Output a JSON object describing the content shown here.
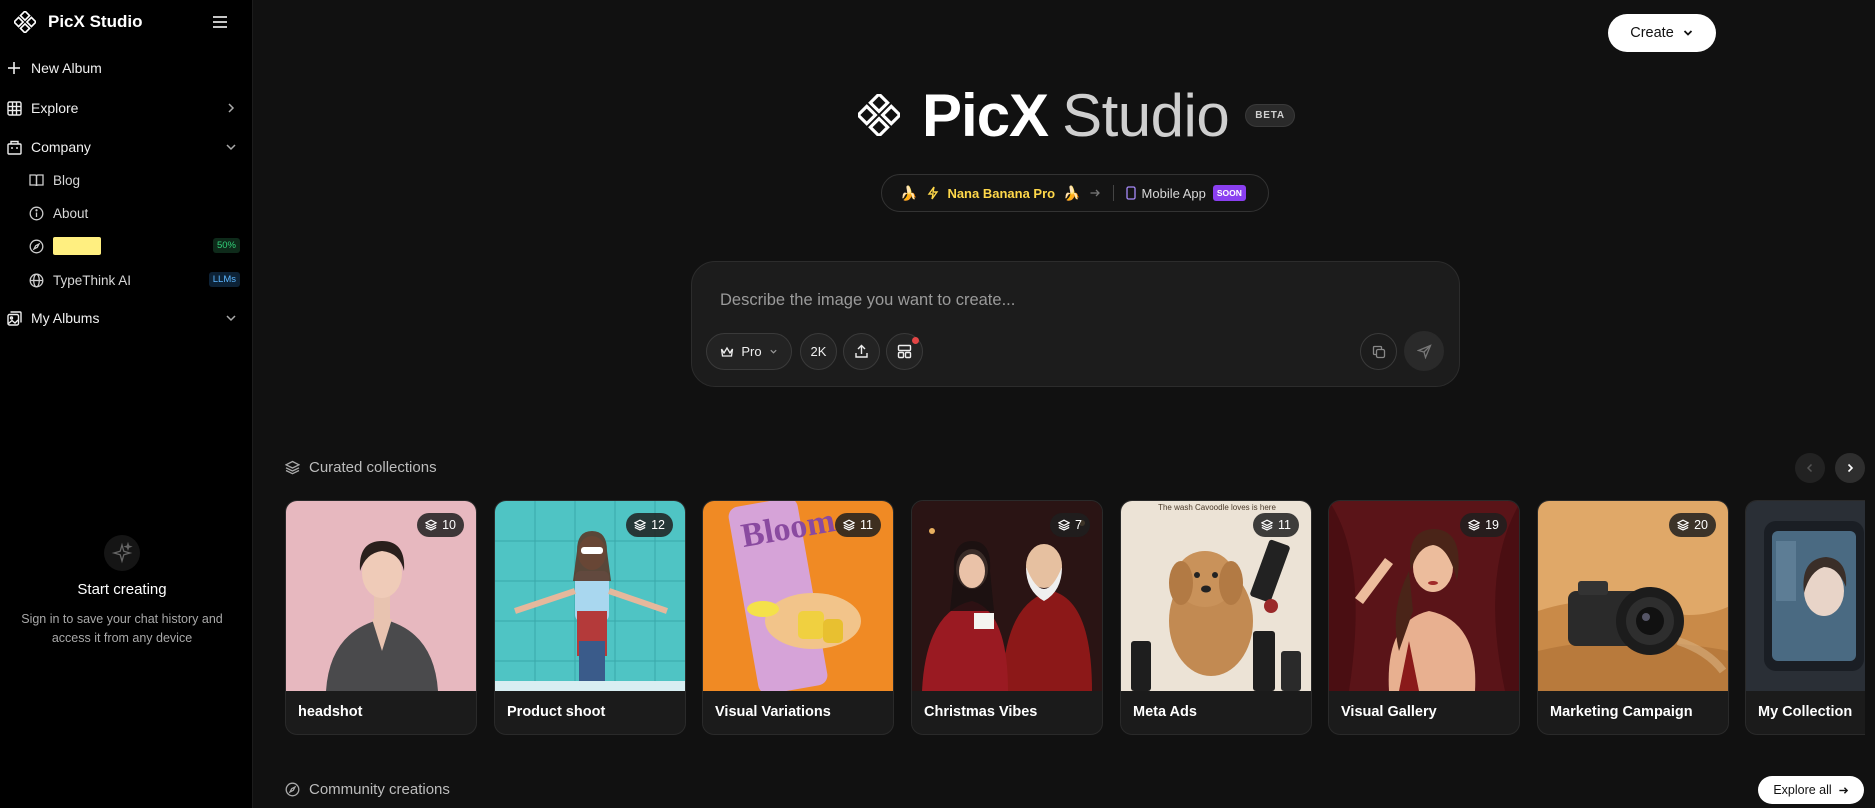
{
  "sidebar": {
    "brand": "PicX Studio",
    "new_album": "New Album",
    "explore": "Explore",
    "company": "Company",
    "company_items": [
      {
        "label": "Blog",
        "icon": "book-icon"
      },
      {
        "label": "About",
        "icon": "info-icon"
      },
      {
        "label": "",
        "icon": "compass-icon",
        "badge": "50%"
      },
      {
        "label": "TypeThink AI",
        "icon": "globe-icon",
        "badge": "LLMs"
      }
    ],
    "my_albums": "My Albums",
    "start": {
      "title": "Start creating",
      "desc_line1": "Sign in to save your chat history and",
      "desc_line2": "access it from any device"
    }
  },
  "header": {
    "create_label": "Create"
  },
  "hero": {
    "title_bold": "PicX",
    "title_light": "Studio",
    "beta": "BETA",
    "promo": "Nana Banana Pro",
    "mobile": "Mobile App",
    "soon": "SOON"
  },
  "composer": {
    "placeholder": "Describe the image you want to create...",
    "model": "Pro",
    "resolution": "2K"
  },
  "collections": {
    "title": "Curated collections",
    "items": [
      {
        "label": "headshot",
        "count": "10"
      },
      {
        "label": "Product shoot",
        "count": "12"
      },
      {
        "label": "Visual Variations",
        "count": "11"
      },
      {
        "label": "Christmas Vibes",
        "count": "7"
      },
      {
        "label": "Meta Ads",
        "count": "11"
      },
      {
        "label": "Visual Gallery",
        "count": "19"
      },
      {
        "label": "Marketing Campaign",
        "count": "20"
      },
      {
        "label": "My Collection",
        "count": ""
      }
    ],
    "meta_banner": "The wash Cavoodle loves is here"
  },
  "community": {
    "title": "Community creations",
    "explore_all": "Explore all"
  },
  "colors": {
    "background": "#111111",
    "sidebar": "#000000",
    "promo_yellow": "#ffd84a",
    "soon_purple": "#8a3ff0",
    "badge_green": "#32d27a",
    "badge_blue": "#5cb6ff"
  }
}
